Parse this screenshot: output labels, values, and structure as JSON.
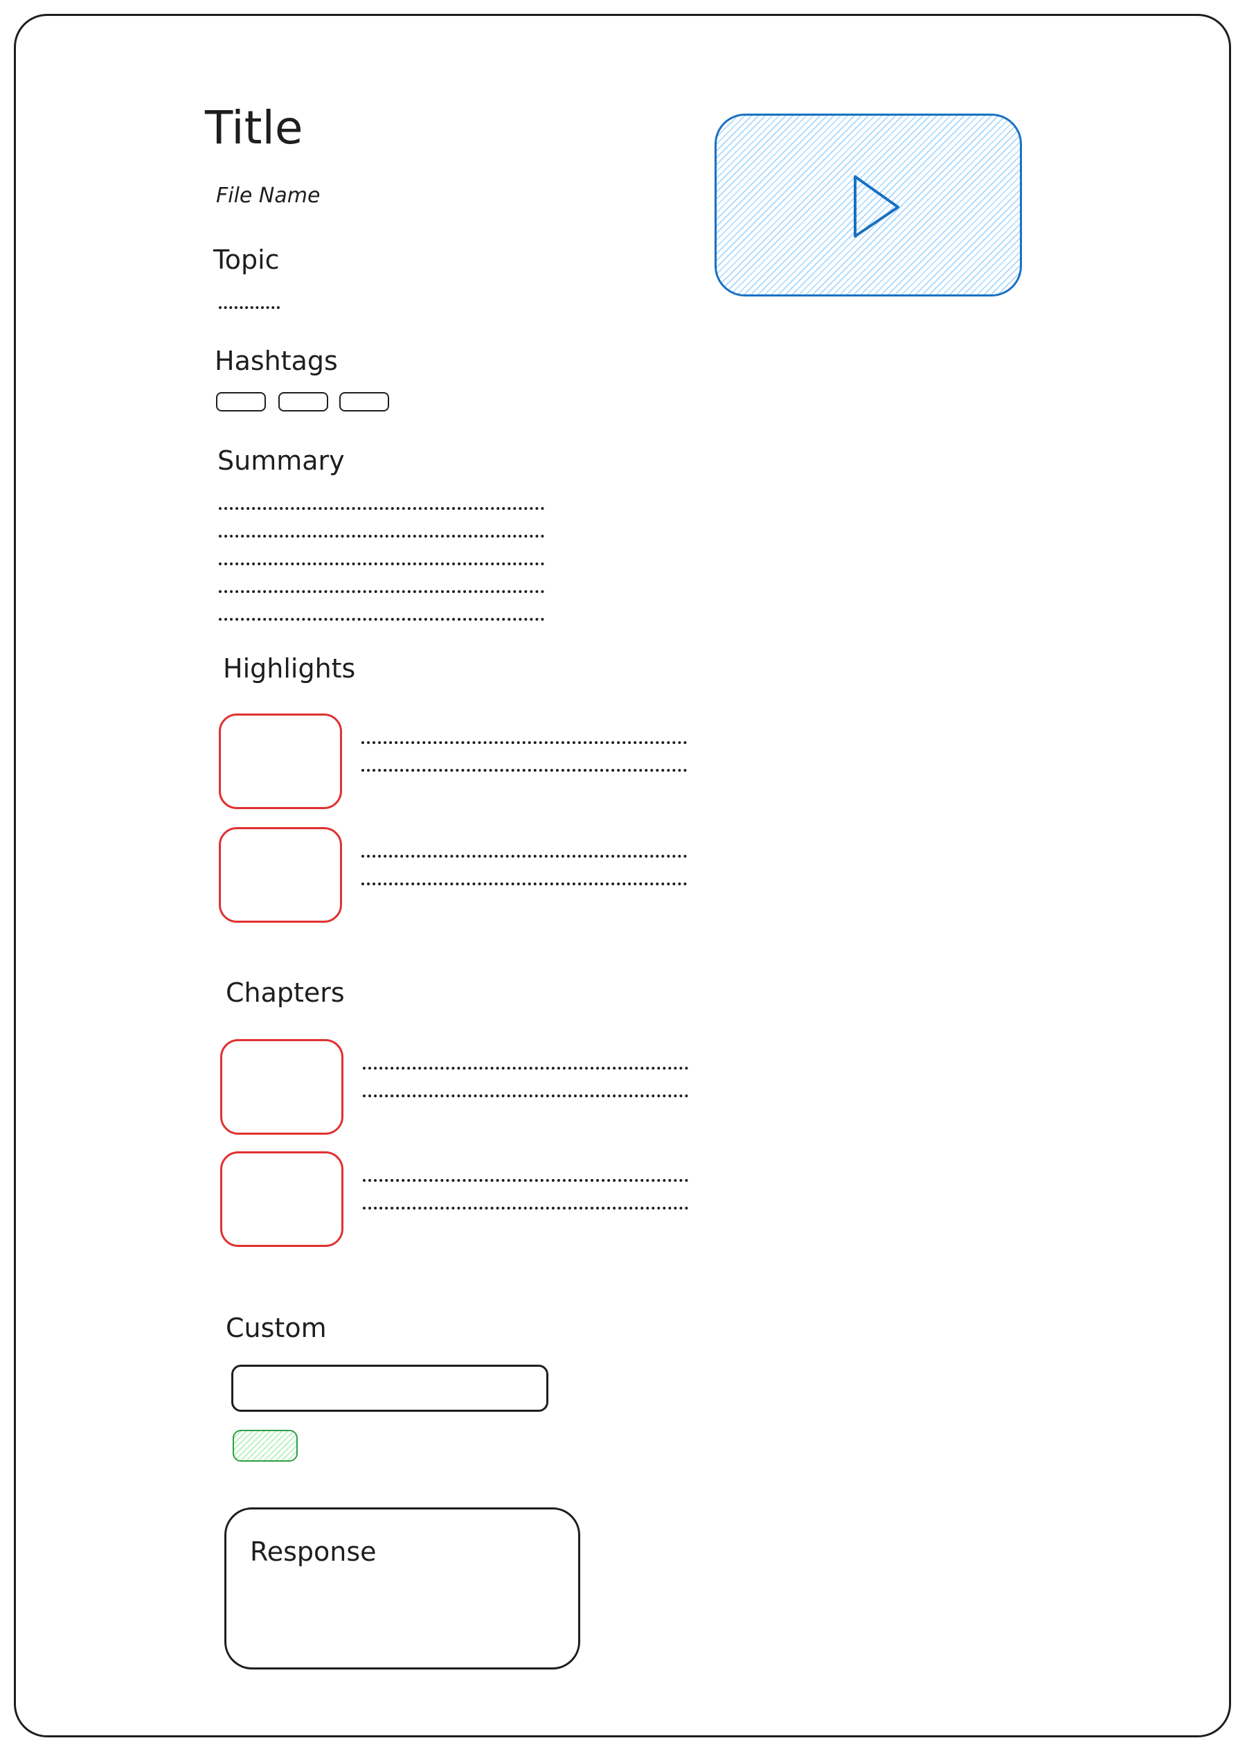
{
  "header": {
    "title": "Title",
    "file_name": "File Name"
  },
  "sections": {
    "topic": "Topic",
    "hashtags": "Hashtags",
    "summary": "Summary",
    "highlights": "Highlights",
    "chapters": "Chapters",
    "custom": "Custom"
  },
  "response": {
    "label": "Response"
  },
  "video": {
    "icon": "play-icon"
  },
  "colors": {
    "ink": "#1e1e1e",
    "thumb_border": "#e03131",
    "video_border": "#1971c2",
    "video_fill": "#a5d8ff",
    "button_border": "#2f9e44",
    "button_fill": "#b2f2bb"
  }
}
